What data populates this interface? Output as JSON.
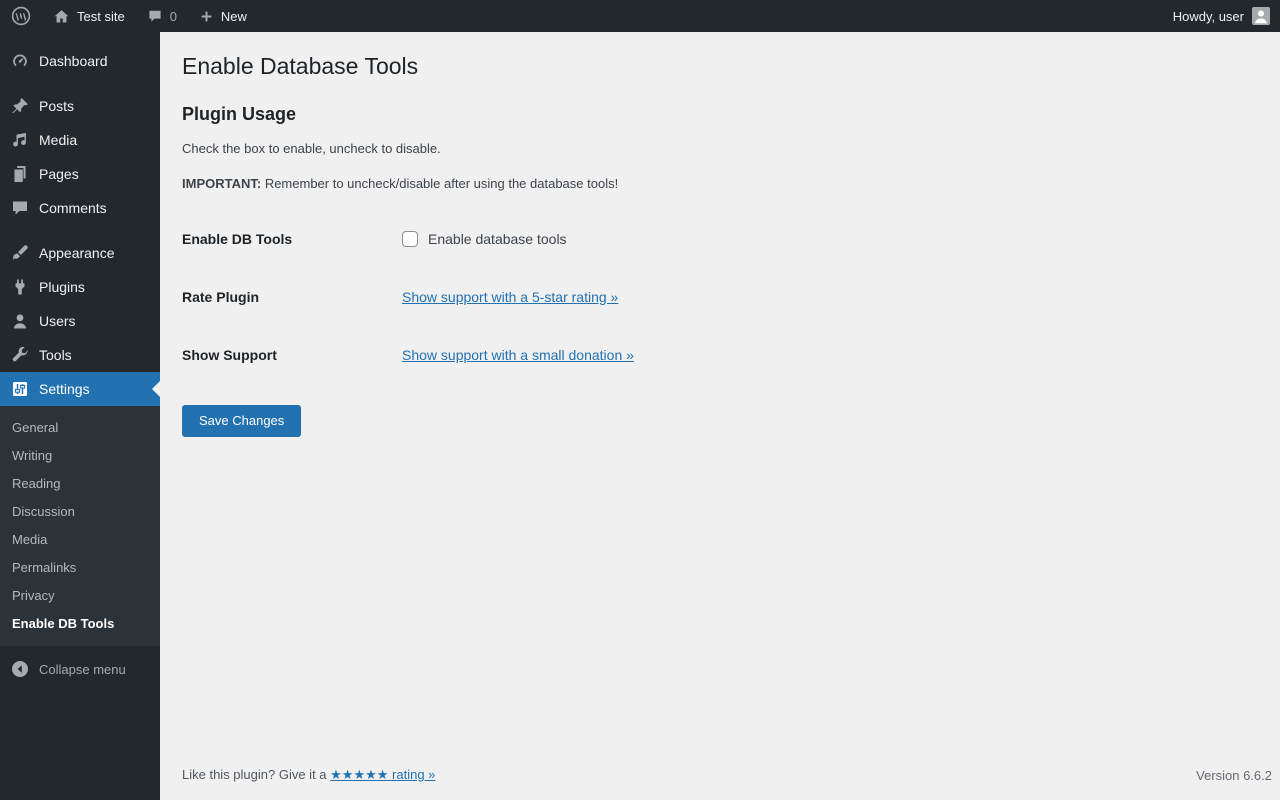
{
  "admin_bar": {
    "site_name": "Test site",
    "comment_count": "0",
    "new_label": "New",
    "howdy": "Howdy, user"
  },
  "sidebar": {
    "items": [
      {
        "label": "Dashboard"
      },
      {
        "label": "Posts"
      },
      {
        "label": "Media"
      },
      {
        "label": "Pages"
      },
      {
        "label": "Comments"
      },
      {
        "label": "Appearance"
      },
      {
        "label": "Plugins"
      },
      {
        "label": "Users"
      },
      {
        "label": "Tools"
      },
      {
        "label": "Settings",
        "active": true
      }
    ],
    "submenu": [
      {
        "label": "General"
      },
      {
        "label": "Writing"
      },
      {
        "label": "Reading"
      },
      {
        "label": "Discussion"
      },
      {
        "label": "Media"
      },
      {
        "label": "Permalinks"
      },
      {
        "label": "Privacy"
      },
      {
        "label": "Enable DB Tools",
        "current": true
      }
    ],
    "collapse_label": "Collapse menu"
  },
  "main": {
    "title": "Enable Database Tools",
    "section_title": "Plugin Usage",
    "intro": "Check the box to enable, uncheck to disable.",
    "important_label": "IMPORTANT:",
    "important_text": " Remember to uncheck/disable after using the database tools!",
    "rows": [
      {
        "label": "Enable DB Tools",
        "checkbox_label": "Enable database tools",
        "checked": false
      },
      {
        "label": "Rate Plugin",
        "link_text": "Show support with a 5-star rating »"
      },
      {
        "label": "Show Support",
        "link_text": "Show support with a small donation »"
      }
    ],
    "save_button": "Save Changes"
  },
  "footer": {
    "like_text": "Like this plugin? Give it a ",
    "rating_link": "★★★★★ rating »",
    "version": "Version 6.6.2"
  },
  "colors": {
    "accent": "#2271b1",
    "admin_bar_bg": "#23282d",
    "submenu_bg": "#2c3338",
    "content_bg": "#f0f0f1"
  }
}
